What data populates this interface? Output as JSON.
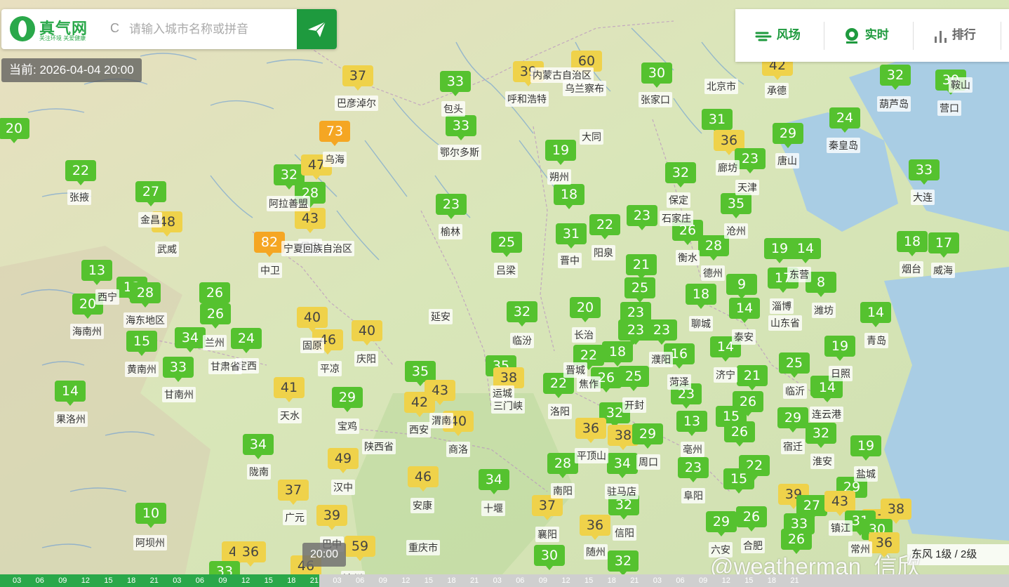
{
  "header": {
    "logo_name": "真气网",
    "logo_slogan": "关注环境 关爱健康",
    "refresh_symbol": "C",
    "search_placeholder": "请输入城市名称或拼音",
    "send_icon": "paper-plane-icon"
  },
  "timestamp": "当前: 2026-04-04 20:00",
  "nav": {
    "wind": "风场",
    "realtime": "实时",
    "ranking": "排行"
  },
  "colors": {
    "good": "#55c22f",
    "moderate": "#efd24a",
    "sensitive": "#f5a623",
    "brand": "#1e9a3e"
  },
  "markers": [
    {
      "v": "20",
      "c": "good"
    },
    {
      "v": "37",
      "c": "mod"
    },
    {
      "v": "33",
      "c": "good"
    },
    {
      "v": "39",
      "c": "mod"
    },
    {
      "v": "60",
      "c": "mod"
    },
    {
      "v": "30",
      "c": "good"
    },
    {
      "v": "42",
      "c": "mod"
    },
    {
      "v": "32",
      "c": "good"
    },
    {
      "v": "30",
      "c": "good"
    },
    {
      "v": "28",
      "c": "good"
    },
    {
      "v": "31",
      "c": "good"
    },
    {
      "v": "24",
      "c": "good"
    },
    {
      "v": "73",
      "c": "sens"
    },
    {
      "v": "33",
      "c": "good"
    },
    {
      "v": "36",
      "c": "mod"
    },
    {
      "v": "29",
      "c": "good"
    },
    {
      "v": "22",
      "c": "good"
    },
    {
      "v": "32",
      "c": "good"
    },
    {
      "v": "47",
      "c": "mod"
    },
    {
      "v": "19",
      "c": "good"
    },
    {
      "v": "23",
      "c": "good"
    },
    {
      "v": "33",
      "c": "good"
    },
    {
      "v": "27",
      "c": "good"
    },
    {
      "v": "28",
      "c": "good"
    },
    {
      "v": "23",
      "c": "good"
    },
    {
      "v": "18",
      "c": "good"
    },
    {
      "v": "32",
      "c": "good"
    },
    {
      "v": "48",
      "c": "mod"
    },
    {
      "v": "43",
      "c": "mod"
    },
    {
      "v": "35",
      "c": "good"
    },
    {
      "v": "82",
      "c": "sens"
    },
    {
      "v": "25",
      "c": "good"
    },
    {
      "v": "31",
      "c": "good"
    },
    {
      "v": "22",
      "c": "good"
    },
    {
      "v": "23",
      "c": "good"
    },
    {
      "v": "26",
      "c": "good"
    },
    {
      "v": "28",
      "c": "good"
    },
    {
      "v": "19",
      "c": "good"
    },
    {
      "v": "14",
      "c": "good"
    },
    {
      "v": "18",
      "c": "good"
    },
    {
      "v": "17",
      "c": "good"
    },
    {
      "v": "13",
      "c": "good"
    },
    {
      "v": "21",
      "c": "good"
    },
    {
      "v": "17",
      "c": "good"
    },
    {
      "v": "8",
      "c": "good"
    },
    {
      "v": "26",
      "c": "good"
    },
    {
      "v": "12",
      "c": "good"
    },
    {
      "v": "28",
      "c": "good"
    },
    {
      "v": "23",
      "c": "good"
    },
    {
      "v": "25",
      "c": "good"
    },
    {
      "v": "9",
      "c": "good"
    },
    {
      "v": "20",
      "c": "good"
    },
    {
      "v": "26",
      "c": "good"
    },
    {
      "v": "40",
      "c": "mod"
    },
    {
      "v": "32",
      "c": "good"
    },
    {
      "v": "20",
      "c": "good"
    },
    {
      "v": "23",
      "c": "good"
    },
    {
      "v": "18",
      "c": "good"
    },
    {
      "v": "14",
      "c": "good"
    },
    {
      "v": "14",
      "c": "good"
    },
    {
      "v": "40",
      "c": "mod"
    },
    {
      "v": "34",
      "c": "good"
    },
    {
      "v": "24",
      "c": "good"
    },
    {
      "v": "46",
      "c": "mod"
    },
    {
      "v": "23",
      "c": "good"
    },
    {
      "v": "23",
      "c": "good"
    },
    {
      "v": "15",
      "c": "good"
    },
    {
      "v": "33",
      "c": "good"
    },
    {
      "v": "14",
      "c": "good"
    },
    {
      "v": "22",
      "c": "good"
    },
    {
      "v": "18",
      "c": "good"
    },
    {
      "v": "16",
      "c": "good"
    },
    {
      "v": "14",
      "c": "good"
    },
    {
      "v": "19",
      "c": "good"
    },
    {
      "v": "35",
      "c": "good"
    },
    {
      "v": "25",
      "c": "good"
    },
    {
      "v": "35",
      "c": "good"
    },
    {
      "v": "38",
      "c": "mod"
    },
    {
      "v": "26",
      "c": "good"
    },
    {
      "v": "25",
      "c": "good"
    },
    {
      "v": "21",
      "c": "good"
    },
    {
      "v": "24",
      "c": "good"
    },
    {
      "v": "14",
      "c": "good"
    },
    {
      "v": "41",
      "c": "mod"
    },
    {
      "v": "29",
      "c": "good"
    },
    {
      "v": "43",
      "c": "mod"
    },
    {
      "v": "42",
      "c": "mod"
    },
    {
      "v": "22",
      "c": "good"
    },
    {
      "v": "23",
      "c": "good"
    },
    {
      "v": "26",
      "c": "good"
    },
    {
      "v": "40",
      "c": "mod"
    },
    {
      "v": "32",
      "c": "good"
    },
    {
      "v": "15",
      "c": "good"
    },
    {
      "v": "29",
      "c": "good"
    },
    {
      "v": "36",
      "c": "mod"
    },
    {
      "v": "38",
      "c": "mod"
    },
    {
      "v": "29",
      "c": "good"
    },
    {
      "v": "13",
      "c": "good"
    },
    {
      "v": "26",
      "c": "good"
    },
    {
      "v": "32",
      "c": "good"
    },
    {
      "v": "19",
      "c": "good"
    },
    {
      "v": "34",
      "c": "good"
    },
    {
      "v": "28",
      "c": "good"
    },
    {
      "v": "34",
      "c": "good"
    },
    {
      "v": "23",
      "c": "good"
    },
    {
      "v": "22",
      "c": "good"
    },
    {
      "v": "49",
      "c": "mod"
    },
    {
      "v": "15",
      "c": "good"
    },
    {
      "v": "46",
      "c": "mod"
    },
    {
      "v": "34",
      "c": "good"
    },
    {
      "v": "37",
      "c": "mod"
    },
    {
      "v": "39",
      "c": "mod"
    },
    {
      "v": "27",
      "c": "good"
    },
    {
      "v": "29",
      "c": "good"
    },
    {
      "v": "43",
      "c": "mod"
    },
    {
      "v": "37",
      "c": "mod"
    },
    {
      "v": "32",
      "c": "good"
    },
    {
      "v": "10",
      "c": "good"
    },
    {
      "v": "39",
      "c": "mod"
    },
    {
      "v": "37",
      "c": "mod"
    },
    {
      "v": "29",
      "c": "good"
    },
    {
      "v": "26",
      "c": "good"
    },
    {
      "v": "33",
      "c": "good"
    },
    {
      "v": "31",
      "c": "good"
    },
    {
      "v": "38",
      "c": "mod"
    },
    {
      "v": "36",
      "c": "mod"
    },
    {
      "v": "59",
      "c": "mod"
    },
    {
      "v": "26",
      "c": "good"
    },
    {
      "v": "30",
      "c": "good"
    },
    {
      "v": "42",
      "c": "mod"
    },
    {
      "v": "36",
      "c": "mod"
    },
    {
      "v": "30",
      "c": "good"
    },
    {
      "v": "36",
      "c": "mod"
    },
    {
      "v": "32",
      "c": "good"
    },
    {
      "v": "46",
      "c": "mod"
    },
    {
      "v": "33",
      "c": "good"
    }
  ],
  "cities": [
    "巴彦淖尔",
    "包头",
    "呼和浩特",
    "乌兰察布",
    "张家口",
    "北京市",
    "承德",
    "葫芦岛",
    "营口",
    "鞍山",
    "乌海",
    "鄂尔多斯",
    "大同",
    "廊坊",
    "唐山",
    "秦皇岛",
    "张掖",
    "阿拉善盟",
    "朔州",
    "天津",
    "保定",
    "大连",
    "金昌",
    "武威",
    "榆林",
    "石家庄",
    "沧州",
    "中卫",
    "吴忠",
    "阳泉",
    "衡水",
    "晋中",
    "吕梁",
    "德州",
    "东营",
    "烟台",
    "威海",
    "海东地区",
    "西宁",
    "海南州",
    "延安",
    "淄博",
    "潍坊",
    "聊城",
    "泰安",
    "临汾",
    "长治",
    "固原",
    "平凉",
    "庆阳",
    "兰州",
    "定西",
    "黄南州",
    "甘南州",
    "晋城",
    "焦作",
    "濮阳",
    "菏泽",
    "济宁",
    "临沂",
    "日照",
    "青岛",
    "运城",
    "三门峡",
    "洛阳",
    "开封",
    "天水",
    "宝鸡",
    "西安",
    "渭南",
    "商洛",
    "连云港",
    "果洛州",
    "平顶山",
    "周口",
    "亳州",
    "宿迁",
    "淮安",
    "盐城",
    "陇南",
    "南阳",
    "驻马店",
    "阜阳",
    "汉中",
    "安康",
    "十堰",
    "广元",
    "襄阳",
    "信阳",
    "镇江",
    "阿坝州",
    "巴中",
    "重庆市",
    "随州",
    "六安",
    "合肥",
    "常州",
    "达州",
    "山东省",
    "陕西省",
    "宁夏回族自治区",
    "甘肃省",
    "内蒙古自治区"
  ],
  "timeline": {
    "cursor": "20:00",
    "ticks": [
      "03",
      "06",
      "09",
      "12",
      "15",
      "18",
      "21",
      "03",
      "06",
      "09",
      "12",
      "15",
      "18",
      "21",
      "03",
      "06",
      "09",
      "12",
      "15",
      "18",
      "21",
      "03",
      "06",
      "09",
      "12",
      "15",
      "18",
      "21",
      "03",
      "06",
      "09",
      "12",
      "15",
      "18",
      "21"
    ]
  },
  "wind_info": "东风 1级 / 2级",
  "watermark": "@weatherman_信欣"
}
